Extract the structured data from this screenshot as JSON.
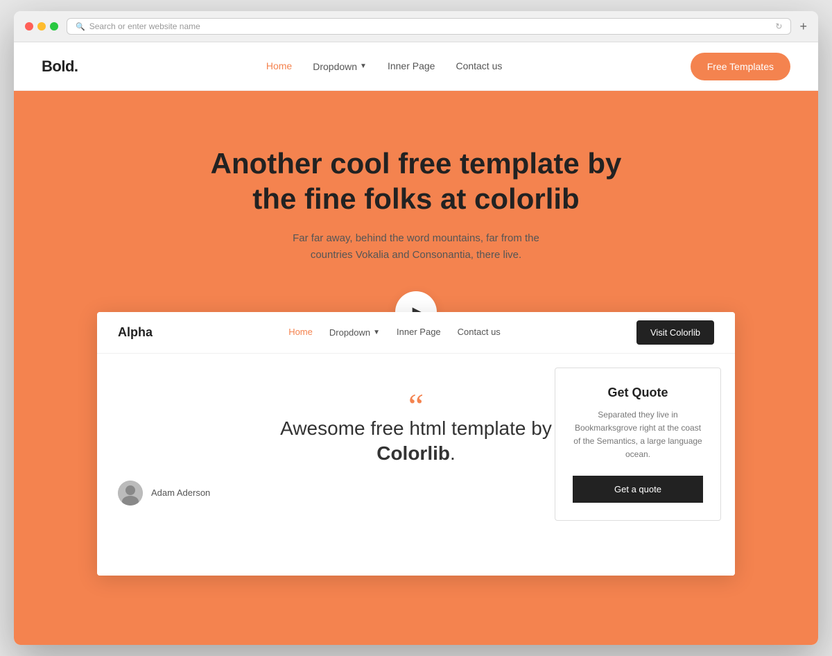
{
  "browser": {
    "address_placeholder": "Search or enter website name",
    "plus_label": "+"
  },
  "top_navbar": {
    "brand": "Bold.",
    "nav_links": [
      {
        "label": "Home",
        "active": true
      },
      {
        "label": "Dropdown",
        "has_dropdown": true
      },
      {
        "label": "Inner Page",
        "active": false
      },
      {
        "label": "Contact us",
        "active": false
      }
    ],
    "cta_button": "Free Templates"
  },
  "hero": {
    "title": "Another cool free template by the fine folks at colorlib",
    "subtitle": "Far far away, behind the word mountains, far from the countries Vokalia and Consonantia, there live.",
    "play_button_label": "▶"
  },
  "inner_site": {
    "brand": "Alpha",
    "nav_links": [
      {
        "label": "Home",
        "active": true
      },
      {
        "label": "Dropdown",
        "has_dropdown": true
      },
      {
        "label": "Inner Page",
        "active": false
      },
      {
        "label": "Contact us",
        "active": false
      }
    ],
    "cta_button": "Visit Colorlib",
    "hero_quote_mark": "“",
    "hero_title_plain": "Awesome free html template by",
    "hero_title_bold": "Colorlib",
    "hero_title_period": ".",
    "author_name": "Adam Aderson",
    "quote_card": {
      "title": "Get Quote",
      "text": "Separated they live in Bookmarksgrove right at the coast of the Semantics, a large language ocean.",
      "button": "Get a quote"
    }
  }
}
